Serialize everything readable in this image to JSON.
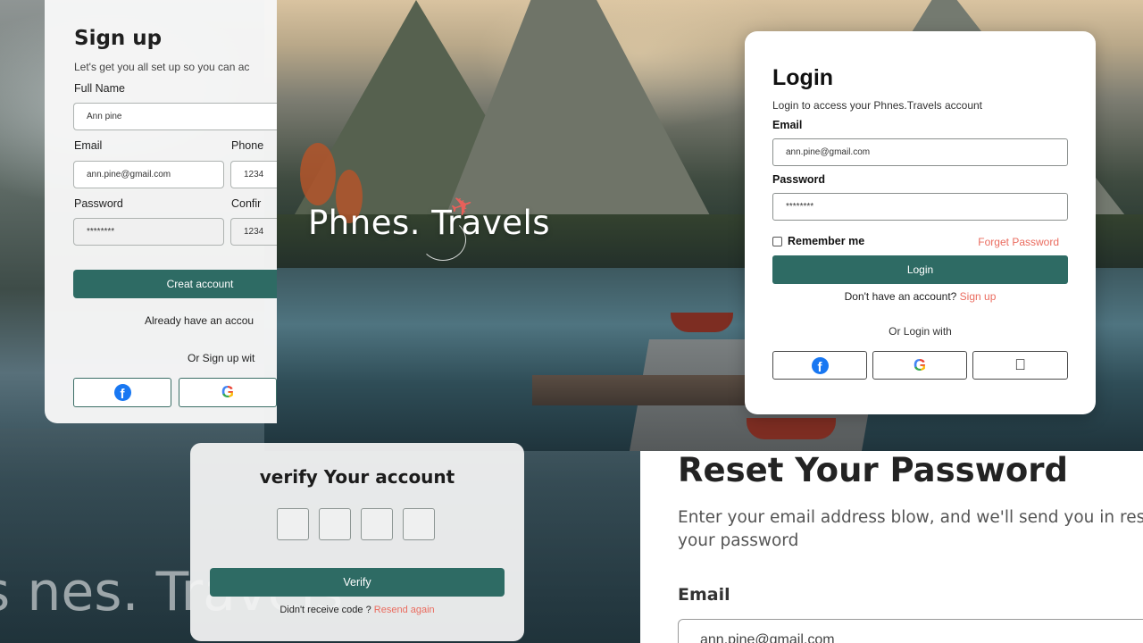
{
  "brand": {
    "name": "Phnes. Travels",
    "accent": "#2e6b64",
    "link_color": "#ea6c5f"
  },
  "signup": {
    "title": "Sign up",
    "subtitle": "Let's get you all set up so you can ac",
    "full_name_label": "Full Name",
    "full_name_value": "Ann pine",
    "email_label": "Email",
    "email_value": "ann.pine@gmail.com",
    "phone_label": "Phone",
    "phone_value": "1234",
    "password_label": "Password",
    "password_value": "********",
    "confirm_label": "Confir",
    "confirm_value": "1234",
    "create_button": "Creat account",
    "already_text": "Already have an accou",
    "or_text": "Or Sign up wit"
  },
  "login": {
    "title": "Login",
    "subtitle": "Login to access your Phnes.Travels account",
    "email_label": "Email",
    "email_value": "ann.pine@gmail.com",
    "password_label": "Password",
    "password_value": "********",
    "remember_label": "Remember me",
    "forget_link": "Forget Password",
    "login_button": "Login",
    "no_account_text": "Don't have an account?",
    "signup_link": "Sign up",
    "or_text": "Or Login with"
  },
  "verify": {
    "title": "verify Your account",
    "verify_button": "Verify",
    "didnt_receive": "Didn't receive code ?",
    "resend_link": "Resend again",
    "ghost_logo": "s  nes. Travels"
  },
  "reset": {
    "title": "Reset Your Password",
    "description": "Enter your email address blow, and we'll send you in reset your password",
    "email_label": "Email",
    "email_value": "ann.pine@gmail.com"
  }
}
